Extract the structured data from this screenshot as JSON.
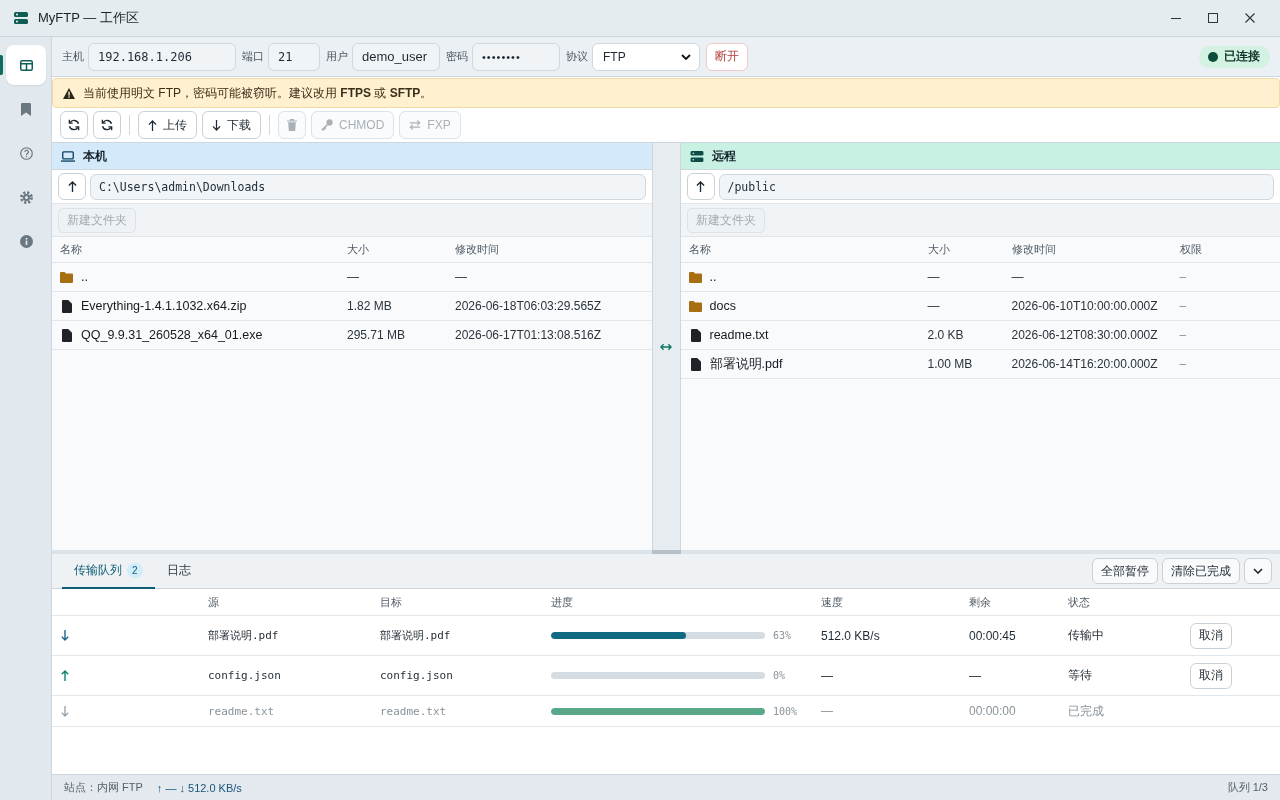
{
  "window": {
    "title": "MyFTP — 工作区"
  },
  "sidebar": {
    "items": [
      {
        "kind": "workspace",
        "selected": true
      },
      {
        "kind": "bookmarks",
        "selected": false
      },
      {
        "kind": "help",
        "selected": false
      },
      {
        "kind": "settings",
        "selected": false
      },
      {
        "kind": "about",
        "selected": false
      }
    ]
  },
  "connection": {
    "fields": [
      {
        "kind": "host",
        "label": "主机",
        "value": "192.168.1.206"
      },
      {
        "kind": "port",
        "label": "端口",
        "value": "21"
      },
      {
        "kind": "user",
        "label": "用户",
        "value": "demo_user"
      },
      {
        "kind": "password",
        "label": "密码",
        "value": "••••••••"
      }
    ],
    "protocol": {
      "label": "协议",
      "value": "FTP"
    },
    "disconnect_button": "断开",
    "status": {
      "label": "已连接",
      "connected": true
    }
  },
  "warning": "当前使用明文 FTP，密码可能被窃听。建议改用 **FTPS** 或 **SFTP**。",
  "toolbar": {
    "groups": [
      [
        {
          "kind": "refresh",
          "disabled": false
        },
        {
          "kind": "refresh",
          "disabled": false
        }
      ],
      [
        {
          "kind": "upload",
          "label": "上传",
          "disabled": false
        },
        {
          "kind": "download",
          "label": "下载",
          "disabled": false
        }
      ],
      [
        {
          "kind": "delete",
          "disabled": true
        },
        {
          "kind": "chmod",
          "label": "CHMOD",
          "disabled": true
        },
        {
          "kind": "fxp",
          "label": "FXP",
          "disabled": true
        }
      ]
    ]
  },
  "panes": [
    {
      "kind": "local",
      "title": "本机",
      "path": "C:\\Users\\admin\\Downloads",
      "new_folder_button": "新建文件夹",
      "new_folder_disabled": true,
      "columns": [
        "名称",
        "大小",
        "修改时间"
      ],
      "rows": [
        {
          "kind": "folder",
          "cells": [
            "..",
            "—",
            "—"
          ]
        },
        {
          "kind": "file",
          "cells": [
            "Everything-1.4.1.1032.x64.zip",
            "1.82 MB",
            "2026-06-18T06:03:29.565Z"
          ]
        },
        {
          "kind": "file",
          "cells": [
            "QQ_9.9.31_260528_x64_01.exe",
            "295.71 MB",
            "2026-06-17T01:13:08.516Z"
          ]
        }
      ]
    },
    {
      "kind": "remote",
      "title": "远程",
      "path": "/public",
      "new_folder_button": "新建文件夹",
      "new_folder_disabled": true,
      "columns": [
        "名称",
        "大小",
        "修改时间",
        "权限"
      ],
      "rows": [
        {
          "kind": "folder",
          "cells": [
            "..",
            "—",
            "—",
            "–"
          ]
        },
        {
          "kind": "folder",
          "cells": [
            "docs",
            "—",
            "2026-06-10T10:00:00.000Z",
            "–"
          ]
        },
        {
          "kind": "file",
          "cells": [
            "readme.txt",
            "2.0 KB",
            "2026-06-12T08:30:00.000Z",
            "–"
          ]
        },
        {
          "kind": "file",
          "cells": [
            "部署说明.pdf",
            "1.00 MB",
            "2026-06-14T16:20:00.000Z",
            "–"
          ]
        }
      ]
    }
  ],
  "transfers": {
    "tabs": [
      {
        "label": "传输队列",
        "badge": "2",
        "selected": true
      },
      {
        "label": "日志",
        "selected": false
      }
    ],
    "buttons": [
      "全部暂停",
      "清除已完成"
    ],
    "columns": [
      "源",
      "目标",
      "进度",
      "速度",
      "剩余",
      "状态"
    ],
    "rows": [
      {
        "kind": "active",
        "upload": false,
        "source": "部署说明.pdf",
        "target": "部署说明.pdf",
        "level": 0.63,
        "percent": "63%",
        "speed": "512.0 KB/s",
        "remaining": "00:00:45",
        "status": "传输中",
        "action": "取消"
      },
      {
        "kind": "waiting",
        "upload": true,
        "source": "config.json",
        "target": "config.json",
        "level": 0,
        "percent": "0%",
        "speed": "—",
        "remaining": "—",
        "status": "等待",
        "action": "取消"
      },
      {
        "kind": "done",
        "upload": false,
        "source": "readme.txt",
        "target": "readme.txt",
        "level": 1,
        "percent": "100%",
        "speed": "—",
        "remaining": "00:00:00",
        "status": "已完成"
      }
    ]
  },
  "status_bar": {
    "site": "站点：内网 FTP",
    "rates": "↑ — ↓ 512.0 KB/s",
    "queue": "队列 1/3"
  }
}
